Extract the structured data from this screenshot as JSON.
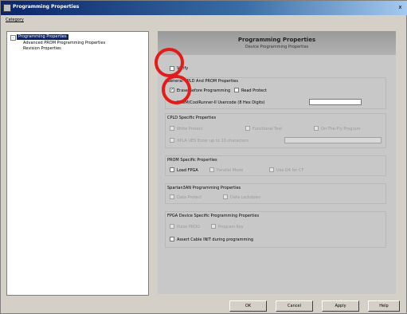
{
  "window": {
    "title": "Programming Properties",
    "close_glyph": "x"
  },
  "menu": {
    "category": "Category"
  },
  "tree": {
    "items": [
      {
        "label": "Programming Properties",
        "selected": true
      },
      {
        "label": "Advanced PROM Programming Properties",
        "selected": false
      },
      {
        "label": "Revision Properties",
        "selected": false
      }
    ],
    "expander": "-"
  },
  "header": {
    "title": "Programming Properties",
    "subtitle": "Device Programming Properties"
  },
  "content": {
    "verify": "Verify",
    "general_group": "General CPLD And PROM Properties",
    "erase_before": "Erase Before Programming",
    "read_protect": "Read Protect",
    "usercode_label": "PROM/CoolRunner-II Usercode (8 Hex Digits)",
    "cpld_group": "CPLD Specific Properties",
    "write_protect": "Write Protect",
    "functional_test": "Functional Test",
    "on_the_fly": "On-The-Fly Program",
    "xpla_usercode": "XPLA UES Enter up to 10 characters",
    "prom_group": "PROM Specific Properties",
    "load_fpga": "Load FPGA",
    "parallel_mode": "Parallel Mode",
    "use_d4_d7": "Use D4 for CF",
    "spartan_group": "Spartan3AN Programming Properties",
    "data_protect": "Data Protect",
    "data_lockdown": "Data Lockdown",
    "fpga_group": "FPGA Device Specific Programming Properties",
    "pulse_prog": "Pulse PROG",
    "program_key": "Program Key",
    "assert_cable": "Assert Cable INIT during programming"
  },
  "buttons": {
    "ok": "OK",
    "cancel": "Cancel",
    "apply": "Apply",
    "help": "Help"
  },
  "colors": {
    "highlight_ring": "#e41b17",
    "selection": "#0a246a"
  }
}
